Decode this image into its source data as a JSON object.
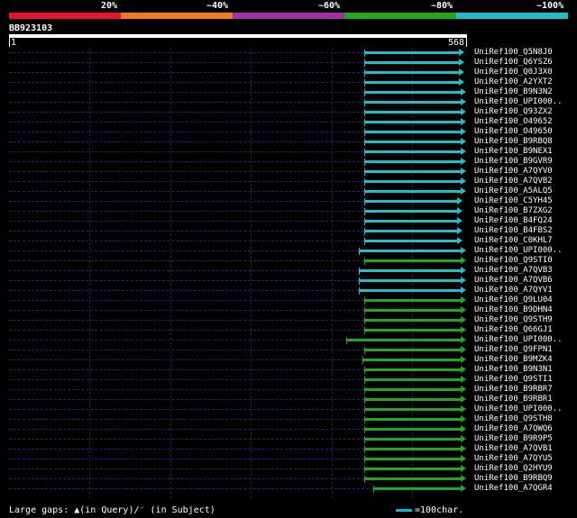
{
  "legend": {
    "labels": [
      "20%",
      "~40%",
      "~60%",
      "~80%",
      "~100%"
    ],
    "colors": [
      "#e8142a",
      "#f07c1e",
      "#a030a8",
      "#22a81e",
      "#1fbec8"
    ]
  },
  "query": {
    "id": "BB923103",
    "start": "1",
    "end": "568",
    "length": 568
  },
  "hits": [
    {
      "label": "UniRef100_Q5N8J0",
      "start": 440,
      "end": 564,
      "color": "#1fbec8"
    },
    {
      "label": "UniRef100_Q6YSZ6",
      "start": 440,
      "end": 564,
      "color": "#1fbec8"
    },
    {
      "label": "UniRef100_Q0J3X0",
      "start": 440,
      "end": 564,
      "color": "#1fbec8"
    },
    {
      "label": "UniRef100_A2YXT2",
      "start": 440,
      "end": 564,
      "color": "#1fbec8"
    },
    {
      "label": "UniRef100_B9N3N2",
      "start": 440,
      "end": 566,
      "color": "#1fbec8"
    },
    {
      "label": "UniRef100_UPI000..",
      "start": 440,
      "end": 566,
      "color": "#1fbec8"
    },
    {
      "label": "UniRef100_Q93ZX2",
      "start": 440,
      "end": 566,
      "color": "#1fbec8"
    },
    {
      "label": "UniRef100_O49652",
      "start": 440,
      "end": 566,
      "color": "#1fbec8"
    },
    {
      "label": "UniRef100_O49650",
      "start": 440,
      "end": 566,
      "color": "#1fbec8"
    },
    {
      "label": "UniRef100_B9RBQ8",
      "start": 440,
      "end": 566,
      "color": "#1fbec8"
    },
    {
      "label": "UniRef100_B9NEX1",
      "start": 440,
      "end": 566,
      "color": "#1fbec8"
    },
    {
      "label": "UniRef100_B9GVR9",
      "start": 440,
      "end": 566,
      "color": "#1fbec8"
    },
    {
      "label": "UniRef100_A7QYV0",
      "start": 440,
      "end": 566,
      "color": "#1fbec8"
    },
    {
      "label": "UniRef100_A7QVB2",
      "start": 440,
      "end": 566,
      "color": "#1fbec8"
    },
    {
      "label": "UniRef100_A5ALQ5",
      "start": 440,
      "end": 566,
      "color": "#1fbec8"
    },
    {
      "label": "UniRef100_C5YH45",
      "start": 440,
      "end": 561,
      "color": "#1fbec8"
    },
    {
      "label": "UniRef100_B7ZXG2",
      "start": 440,
      "end": 561,
      "color": "#1fbec8"
    },
    {
      "label": "UniRef100_B4FQ24",
      "start": 440,
      "end": 561,
      "color": "#1fbec8"
    },
    {
      "label": "UniRef100_B4FBS2",
      "start": 440,
      "end": 561,
      "color": "#1fbec8"
    },
    {
      "label": "UniRef100_C0KHL7",
      "start": 440,
      "end": 561,
      "color": "#1fbec8"
    },
    {
      "label": "UniRef100_UPI000..",
      "start": 434,
      "end": 566,
      "color": "#1fbec8"
    },
    {
      "label": "UniRef100_Q9STI0",
      "start": 440,
      "end": 566,
      "color": "#22a81e"
    },
    {
      "label": "UniRef100_A7QVB3",
      "start": 434,
      "end": 566,
      "color": "#1fbec8"
    },
    {
      "label": "UniRef100_A7QVB6",
      "start": 434,
      "end": 566,
      "color": "#1fbec8"
    },
    {
      "label": "UniRef100_A7QYV1",
      "start": 434,
      "end": 566,
      "color": "#1fbec8"
    },
    {
      "label": "UniRef100_Q9LU04",
      "start": 440,
      "end": 566,
      "color": "#22a81e"
    },
    {
      "label": "UniRef100_B9DHN4",
      "start": 440,
      "end": 566,
      "color": "#22a81e"
    },
    {
      "label": "UniRef100_Q9STH9",
      "start": 440,
      "end": 566,
      "color": "#22a81e"
    },
    {
      "label": "UniRef100_Q66GJ1",
      "start": 440,
      "end": 566,
      "color": "#22a81e"
    },
    {
      "label": "UniRef100_UPI000..",
      "start": 418,
      "end": 566,
      "color": "#22a81e"
    },
    {
      "label": "UniRef100_Q9FPN1",
      "start": 440,
      "end": 566,
      "color": "#22a81e"
    },
    {
      "label": "UniRef100_B9MZK4",
      "start": 438,
      "end": 566,
      "color": "#22a81e"
    },
    {
      "label": "UniRef100_B9N3N1",
      "start": 440,
      "end": 566,
      "color": "#22a81e"
    },
    {
      "label": "UniRef100_Q9STI1",
      "start": 440,
      "end": 566,
      "color": "#22a81e"
    },
    {
      "label": "UniRef100_B9RBR7",
      "start": 440,
      "end": 566,
      "color": "#22a81e"
    },
    {
      "label": "UniRef100_B9RBR1",
      "start": 440,
      "end": 566,
      "color": "#22a81e"
    },
    {
      "label": "UniRef100_UPI000..",
      "start": 440,
      "end": 566,
      "color": "#22a81e"
    },
    {
      "label": "UniRef100_Q9STH8",
      "start": 440,
      "end": 566,
      "color": "#22a81e"
    },
    {
      "label": "UniRef100_A7QWQ6",
      "start": 440,
      "end": 566,
      "color": "#22a81e"
    },
    {
      "label": "UniRef100_B9R9P5",
      "start": 440,
      "end": 566,
      "color": "#22a81e"
    },
    {
      "label": "UniRef100_A7QVB1",
      "start": 440,
      "end": 566,
      "color": "#22a81e"
    },
    {
      "label": "UniRef100_A7QYU5",
      "start": 440,
      "end": 566,
      "color": "#22a81e"
    },
    {
      "label": "UniRef100_Q2HYU9",
      "start": 440,
      "end": 566,
      "color": "#22a81e"
    },
    {
      "label": "UniRef100_B9RBQ9",
      "start": 440,
      "end": 566,
      "color": "#22a81e"
    },
    {
      "label": "UniRef100_A7QGR4",
      "start": 452,
      "end": 566,
      "color": "#22a81e"
    }
  ],
  "footer": {
    "gaps_text": "Large gaps: ▲(in Query)/⁻ (in Subject)",
    "scale_text": "=100char."
  },
  "accent": {
    "dash_color": "#1a2a7a",
    "scale_color": "#00bcd4"
  }
}
